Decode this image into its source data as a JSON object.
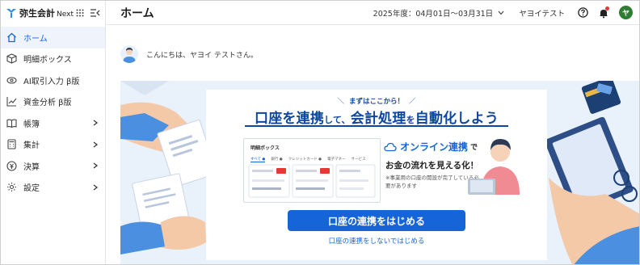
{
  "brand": {
    "name": "弥生会計",
    "suffix": "Next"
  },
  "sidebar": {
    "items": [
      {
        "label": "ホーム",
        "icon": "home-icon",
        "active": true,
        "has_children": false
      },
      {
        "label": "明細ボックス",
        "icon": "box-icon",
        "active": false,
        "has_children": false
      },
      {
        "label": "AI取引入力 β版",
        "icon": "ai-eye-icon",
        "active": false,
        "has_children": false
      },
      {
        "label": "資金分析 β版",
        "icon": "trend-chart-icon",
        "active": false,
        "has_children": false
      },
      {
        "label": "帳簿",
        "icon": "book-icon",
        "active": false,
        "has_children": true
      },
      {
        "label": "集計",
        "icon": "calculator-icon",
        "active": false,
        "has_children": true
      },
      {
        "label": "決算",
        "icon": "settlement-icon",
        "active": false,
        "has_children": true
      },
      {
        "label": "設定",
        "icon": "gear-icon",
        "active": false,
        "has_children": true
      }
    ]
  },
  "header": {
    "title": "ホーム",
    "fiscal_period": "2025年度：04月01日〜03月31日",
    "company": "ヤヨイテスト",
    "avatar_initial": "ヤ"
  },
  "greeting": {
    "text": "こんにちは、ヤヨイ テストさん。"
  },
  "banner": {
    "tagline": "まずはここから！",
    "headline_a": "口座を連携",
    "headline_b": "して、",
    "headline_c": "会計処理",
    "headline_d": "を",
    "headline_e": "自動化しよう",
    "mock_title": "明細ボックス",
    "mock_tabs": [
      "すべて ●",
      "銀行 ●",
      "クレジットカード ●",
      "電子マネー",
      "サービス"
    ],
    "online_label": "オンライン連携",
    "online_suffix": "で",
    "flow_text": "お金の流れを見える化！",
    "note": "※事業用の口座の開設が完了している必要があります",
    "cta_label": "口座の連携をはじめる",
    "skip_label": "口座の連携をしないではじめる"
  },
  "colors": {
    "accent": "#1565d8",
    "headline": "#0d47a1",
    "banner_bg": "#e9f1fb",
    "avatar_bg": "#2e7d32",
    "alert": "#e53935"
  }
}
